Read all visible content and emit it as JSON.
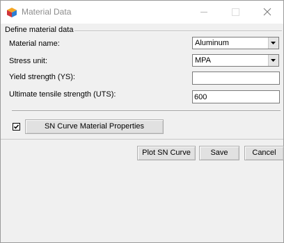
{
  "window": {
    "title": "Material Data",
    "icon": "app-cube-icon"
  },
  "group": {
    "title": "Define material data"
  },
  "fields": {
    "material_name": {
      "label": "Material name:",
      "value": "Aluminum"
    },
    "stress_unit": {
      "label": "Stress unit:",
      "value": "MPA"
    },
    "yield_strength": {
      "label": "Yield strength (YS):",
      "value": ""
    },
    "uts": {
      "label": "Ultimate tensile strength (UTS):",
      "value": "600"
    }
  },
  "sn_curve": {
    "checked": true,
    "button_label": "SN Curve Material Properties"
  },
  "buttons": {
    "plot": "Plot SN Curve",
    "save": "Save",
    "cancel": "Cancel"
  }
}
